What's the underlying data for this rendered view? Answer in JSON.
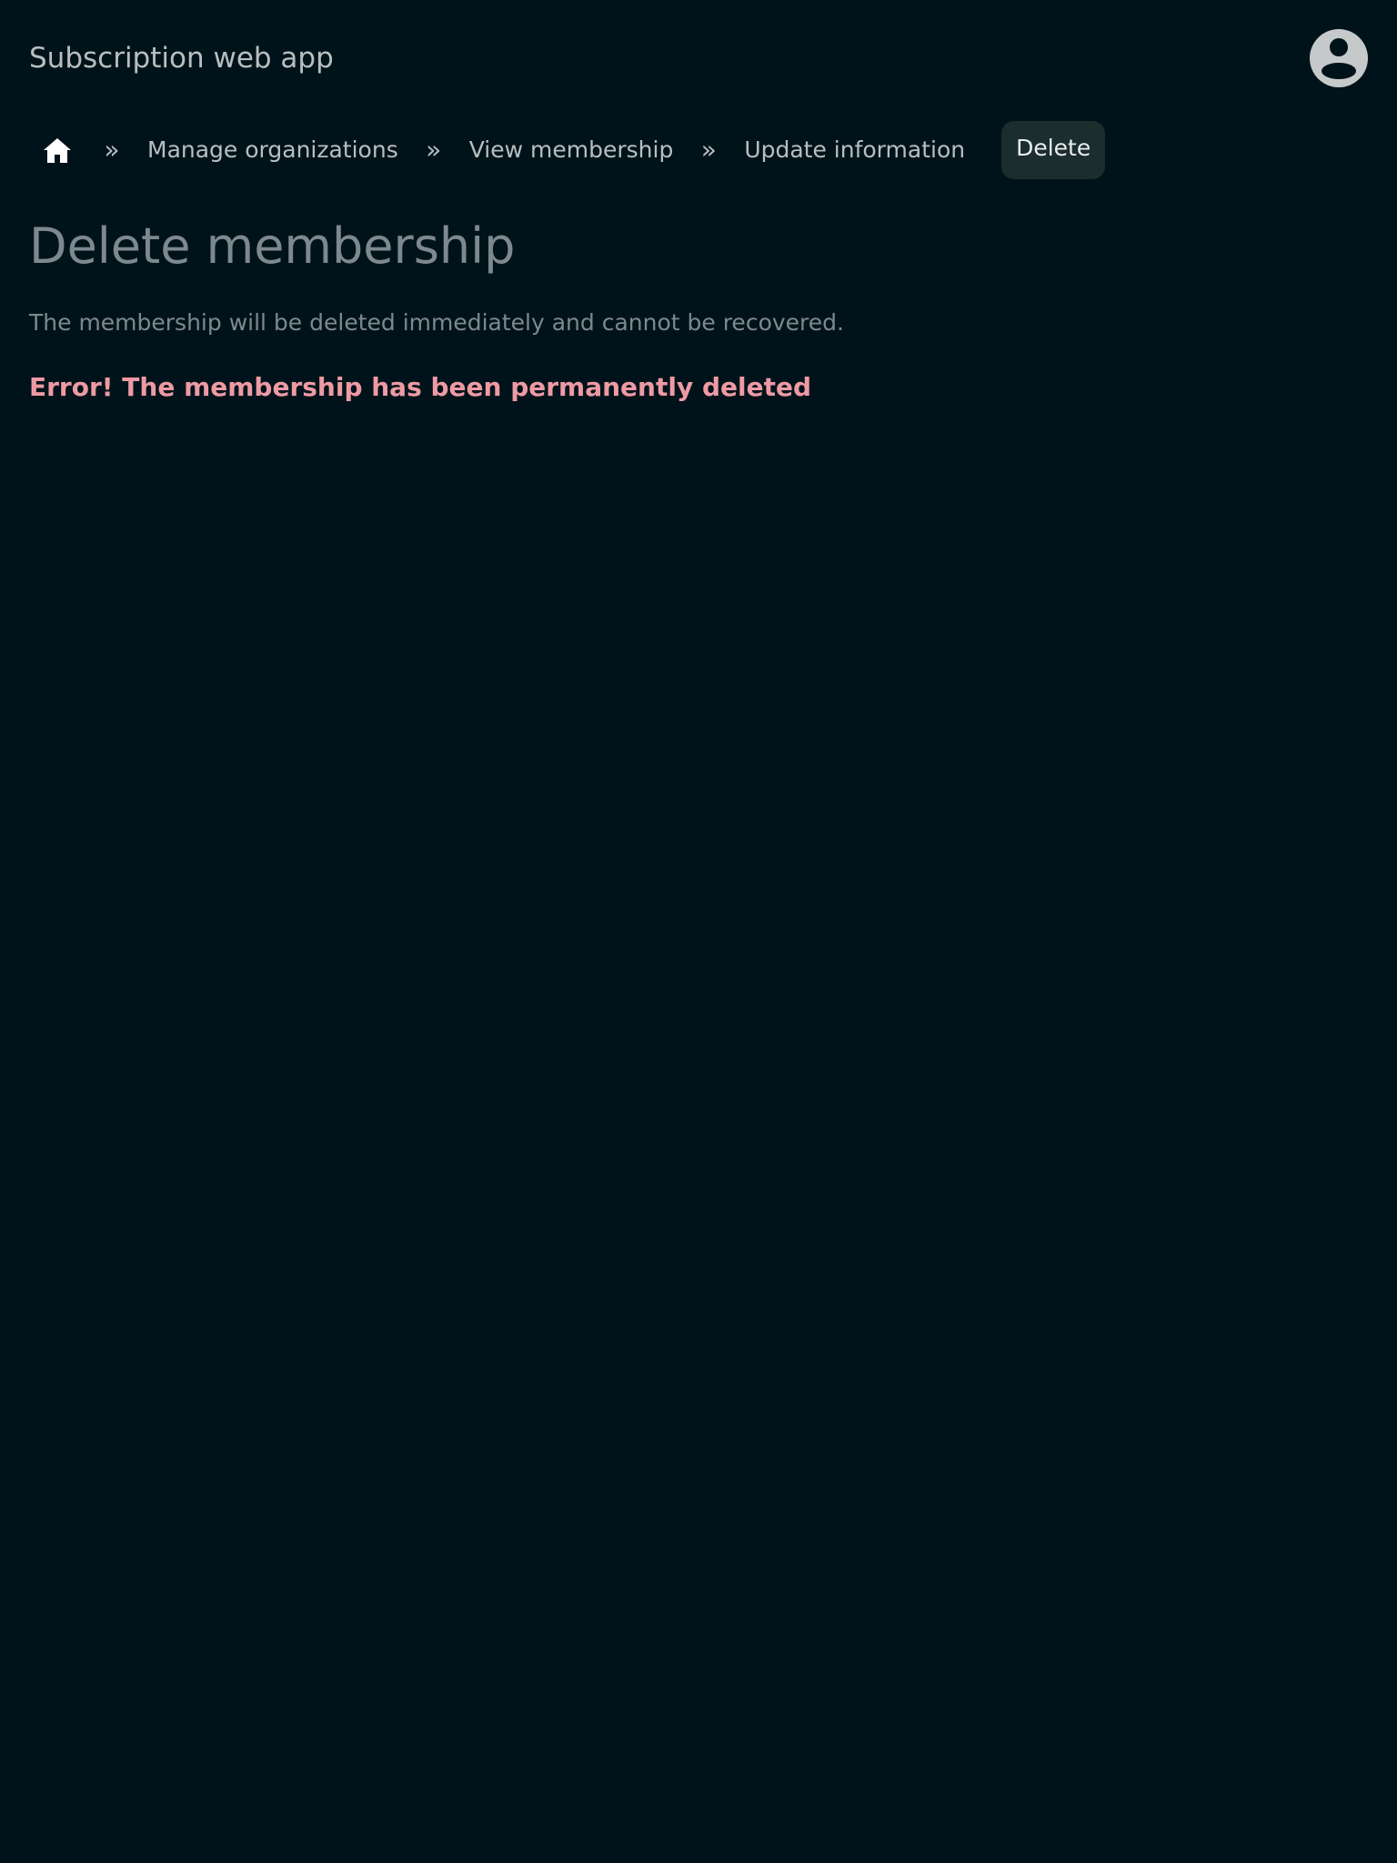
{
  "header": {
    "app_title": "Subscription web app",
    "avatar_icon": "user-circle-icon"
  },
  "breadcrumb": {
    "home_icon": "home-icon",
    "separator": "»",
    "items": [
      {
        "label": "Manage organizations"
      },
      {
        "label": "View membership"
      },
      {
        "label": "Update information"
      }
    ],
    "current": "Delete"
  },
  "main": {
    "title": "Delete membership",
    "description": "The membership will be deleted immediately and cannot be recovered.",
    "error": "Error! The membership has been permanently deleted"
  },
  "colors": {
    "background": "#01131a",
    "error": "#ee9aa4",
    "current_crumb_bg": "#1c2d2e"
  }
}
